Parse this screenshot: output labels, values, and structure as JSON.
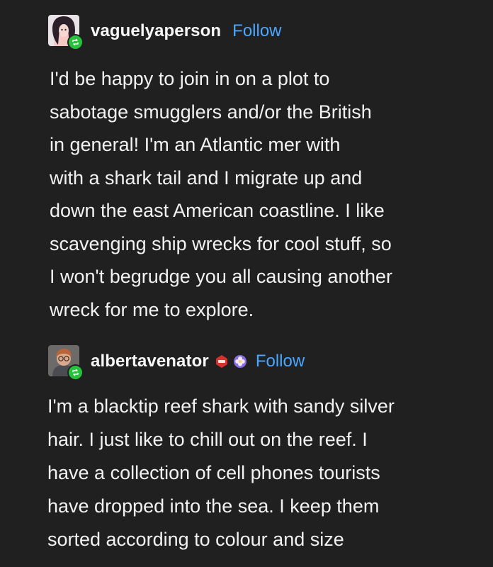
{
  "posts": [
    {
      "username": "vaguelyaperson",
      "follow_label": "Follow",
      "avatar_icon": "user-avatar",
      "badge_icon": "reblog-icon",
      "text": "I'd be happy to join in on a plot to\nsabotage smugglers and/or the British\nin general! I'm an Atlantic mer with\nwith a shark tail and I migrate up and\ndown the east American coastline. I like\nscavenging ship wrecks for cool stuff, so\nI won't begrudge you all causing another\nwreck for me to explore."
    },
    {
      "username": "albertavenator",
      "follow_label": "Follow",
      "avatar_icon": "user-avatar",
      "badge_icon": "reblog-icon",
      "extra_badges": [
        "red-badge-icon",
        "purple-flower-badge-icon"
      ],
      "text": "I'm a blacktip reef shark with sandy silver\nhair. I just like to chill out on the reef. I\nhave a collection of cell phones tourists\nhave dropped into the sea. I keep them\nsorted according to colour and size"
    }
  ],
  "colors": {
    "background": "#202020",
    "text": "#f2f2f2",
    "follow_link": "#4aa7ff",
    "badge_green": "#27c23b"
  }
}
